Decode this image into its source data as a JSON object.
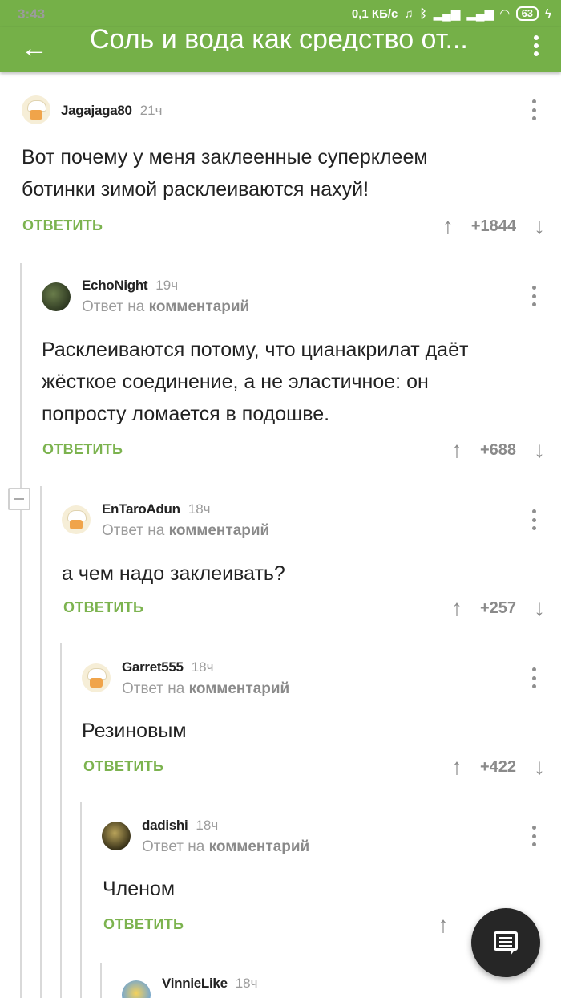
{
  "status_bar": {
    "time": "3:43",
    "net_speed": "0,1 КБ/с",
    "battery": "63"
  },
  "app_bar": {
    "title": "Соль и вода как средство от..."
  },
  "reply_to_text": "Ответ на",
  "reply_to_target": "комментарий",
  "reply_label": "ОТВЕТИТЬ",
  "comments": [
    {
      "user": "Jagajaga80",
      "time": "21ч",
      "lines": [
        "Вот почему у меня заклеенные суперклеем",
        "ботинки зимой расклеиваются нахуй!"
      ],
      "score": "+1844"
    },
    {
      "user": "EchoNight",
      "time": "19ч",
      "lines": [
        "Расклеиваются потому, что цианакрилат даёт",
        "жёсткое соединение, а не эластичное: он",
        "попросту ломается в подошве."
      ],
      "score": "+688"
    },
    {
      "user": "EnTaroAdun",
      "time": "18ч",
      "lines": [
        "а чем надо заклеивать?"
      ],
      "score": "+257"
    },
    {
      "user": "Garret555",
      "time": "18ч",
      "lines": [
        "Резиновым"
      ],
      "score": "+422"
    },
    {
      "user": "dadishi",
      "time": "18ч",
      "lines": [
        "Членом"
      ],
      "score": ""
    },
    {
      "user": "VinnieLike",
      "time": "18ч"
    }
  ]
}
